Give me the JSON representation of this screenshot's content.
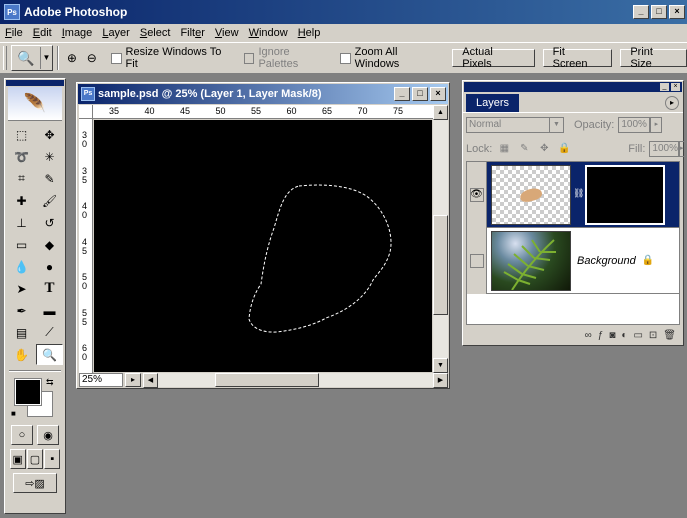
{
  "app": {
    "title": "Adobe Photoshop",
    "logo": "Ps"
  },
  "window_controls": {
    "minimize": "_",
    "maximize": "□",
    "close": "×"
  },
  "menu": [
    {
      "pre": "",
      "u": "F",
      "post": "ile"
    },
    {
      "pre": "",
      "u": "E",
      "post": "dit"
    },
    {
      "pre": "",
      "u": "I",
      "post": "mage"
    },
    {
      "pre": "",
      "u": "L",
      "post": "ayer"
    },
    {
      "pre": "",
      "u": "S",
      "post": "elect"
    },
    {
      "pre": "Filt",
      "u": "e",
      "post": "r"
    },
    {
      "pre": "",
      "u": "V",
      "post": "iew"
    },
    {
      "pre": "",
      "u": "W",
      "post": "indow"
    },
    {
      "pre": "",
      "u": "H",
      "post": "elp"
    }
  ],
  "options": {
    "resize_windows": "Resize Windows To Fit",
    "ignore_palettes": "Ignore Palettes",
    "zoom_all": "Zoom All Windows",
    "actual_pixels": "Actual Pixels",
    "fit_screen": "Fit Screen",
    "print_size": "Print Size"
  },
  "document": {
    "title": "sample.psd @ 25% (Layer 1, Layer Mask/8)",
    "zoom": "25%",
    "ruler_h": [
      "35",
      "40",
      "45",
      "50",
      "55",
      "60",
      "65",
      "70",
      "75"
    ],
    "ruler_v": [
      "30",
      "35",
      "40",
      "45",
      "50",
      "55",
      "60"
    ]
  },
  "layers_panel": {
    "tab": "Layers",
    "blend_mode": "Normal",
    "opacity_label": "Opacity:",
    "opacity_value": "100%",
    "lock_label": "Lock:",
    "fill_label": "Fill:",
    "fill_value": "100%",
    "layers": [
      {
        "name": "",
        "visible": true
      },
      {
        "name": "Background",
        "visible": false
      }
    ]
  },
  "icons": {
    "zoom_tool": "zoom-icon",
    "eye": "eye-icon",
    "lock": "lock-icon"
  }
}
